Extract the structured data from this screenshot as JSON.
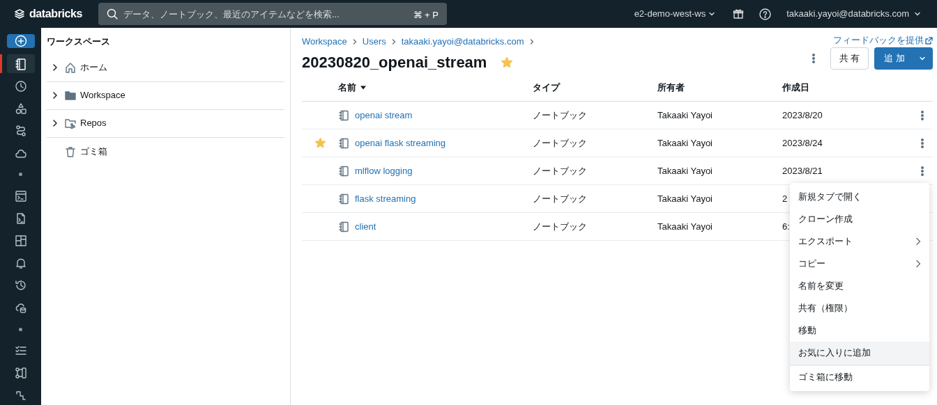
{
  "top_bar": {
    "logo": "databricks",
    "search": {
      "placeholder": "データ、ノートブック、最近のアイテムなどを検索...",
      "shortcut": "⌘ + P"
    },
    "workspace": "e2-demo-west-ws",
    "user": "takaaki.yayoi@databricks.com"
  },
  "rail": [
    {
      "kind": "new",
      "selected": false
    },
    {
      "kind": "icon",
      "selected": true
    },
    {
      "kind": "icon",
      "selected": false
    },
    {
      "kind": "icon",
      "selected": false
    },
    {
      "kind": "icon",
      "selected": false
    },
    {
      "kind": "icon",
      "selected": false
    },
    {
      "kind": "dot",
      "selected": false
    },
    {
      "kind": "icon",
      "selected": false
    },
    {
      "kind": "icon",
      "selected": false
    },
    {
      "kind": "icon",
      "selected": false
    },
    {
      "kind": "icon",
      "selected": false
    },
    {
      "kind": "icon",
      "selected": false
    },
    {
      "kind": "icon",
      "selected": false
    },
    {
      "kind": "dot",
      "selected": false
    },
    {
      "kind": "icon",
      "selected": false
    },
    {
      "kind": "icon",
      "selected": false
    },
    {
      "kind": "icon",
      "selected": false
    }
  ],
  "tree": {
    "title": "ワークスペース",
    "items": [
      {
        "label": "ホーム",
        "kind": "home",
        "expandable": true
      },
      {
        "label": "Workspace",
        "kind": "folder",
        "expandable": true
      },
      {
        "label": "Repos",
        "kind": "repos",
        "expandable": true
      },
      {
        "label": "ゴミ箱",
        "kind": "trash",
        "expandable": false
      }
    ]
  },
  "breadcrumb": [
    "Workspace",
    "Users",
    "takaaki.yayoi@databricks.com"
  ],
  "feedback_link": "フィードバックを提供",
  "page_title": "20230820_openai_stream",
  "title_starred": true,
  "actions": {
    "share": "共 有",
    "add": "追 加"
  },
  "table": {
    "columns": [
      "名前",
      "タイプ",
      "所有者",
      "作成日"
    ],
    "rows": [
      {
        "starred": false,
        "name": "openai stream",
        "type": "ノートブック",
        "owner": "Takaaki Yayoi",
        "created": "2023/8/20",
        "menu_button": true
      },
      {
        "starred": true,
        "name": "openai flask streaming",
        "type": "ノートブック",
        "owner": "Takaaki Yayoi",
        "created": "2023/8/24",
        "menu_button": true
      },
      {
        "starred": false,
        "name": "mlflow logging",
        "type": "ノートブック",
        "owner": "Takaaki Yayoi",
        "created": "2023/8/21",
        "menu_button": true
      },
      {
        "starred": false,
        "name": "flask streaming",
        "type": "ノートブック",
        "owner": "Takaaki Yayoi",
        "created": "2"
      },
      {
        "starred": false,
        "name": "client",
        "type": "ノートブック",
        "owner": "Takaaki Yayoi",
        "created": "6:"
      }
    ]
  },
  "context_menu": [
    {
      "kind": "item",
      "label": "新規タブで開く",
      "submenu": false,
      "highlighted": false
    },
    {
      "kind": "item",
      "label": "クローン作成",
      "submenu": false,
      "highlighted": false
    },
    {
      "kind": "item",
      "label": "エクスポート",
      "submenu": true,
      "highlighted": false
    },
    {
      "kind": "item",
      "label": "コピー",
      "submenu": true,
      "highlighted": false
    },
    {
      "kind": "item",
      "label": "名前を変更",
      "submenu": false,
      "highlighted": false
    },
    {
      "kind": "item",
      "label": "共有（権限）",
      "submenu": false,
      "highlighted": false
    },
    {
      "kind": "item",
      "label": "移動",
      "submenu": false,
      "highlighted": false
    },
    {
      "kind": "item",
      "label": "お気に入りに追加",
      "submenu": false,
      "highlighted": true
    },
    {
      "kind": "divider"
    },
    {
      "kind": "item",
      "label": "ゴミ箱に移動",
      "submenu": false,
      "highlighted": false
    }
  ]
}
